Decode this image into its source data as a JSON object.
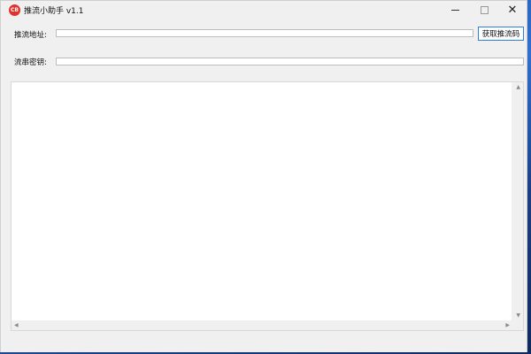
{
  "window": {
    "title": "推流小助手 v1.1",
    "icon": "app-logo-icon"
  },
  "form": {
    "url_label": "推流地址:",
    "url_value": "",
    "key_label": "流串密钥:",
    "key_value": "",
    "get_button_label": "获取推流码"
  },
  "output": {
    "text": ""
  },
  "colors": {
    "accent": "#2f7fd6",
    "icon_red": "#e2322c",
    "window_bg": "#f0f0f0"
  }
}
